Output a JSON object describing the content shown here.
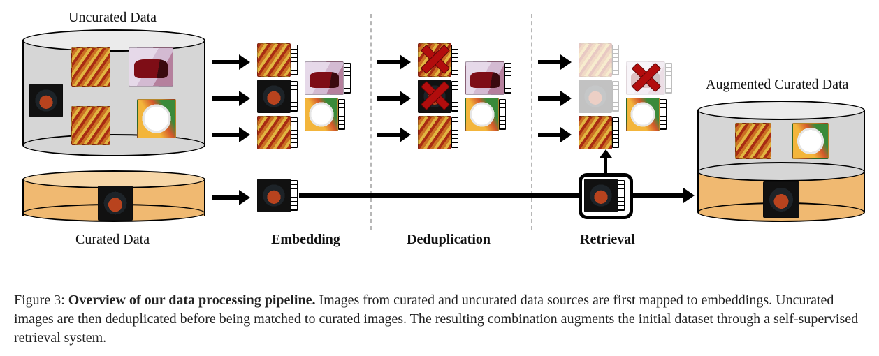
{
  "labels": {
    "uncurated": "Uncurated Data",
    "curated": "Curated Data",
    "augmented": "Augmented Curated Data",
    "embedding": "Embedding",
    "deduplication": "Deduplication",
    "retrieval": "Retrieval"
  },
  "caption": {
    "prefix": "Figure 3: ",
    "title": "Overview of our data processing pipeline.",
    "body": " Images from curated and uncurated data sources are first mapped to embeddings. Uncurated images are then deduplicated before being matched to curated images. The resulting combination augments the initial dataset through a self-supervised retrieval system."
  },
  "pipeline": {
    "stages": [
      "Embedding",
      "Deduplication",
      "Retrieval"
    ],
    "uncurated_samples": [
      "pie",
      "ratatouille",
      "ratatouille2",
      "car",
      "plate"
    ],
    "curated_samples": [
      "pie-curated"
    ],
    "dedup_removed_indices": [
      0,
      1
    ],
    "retrieval_kept": [
      "ratatouille2",
      "plate"
    ],
    "augmented_output": {
      "from_uncurated": [
        "ratatouille2",
        "plate"
      ],
      "from_curated": [
        "pie-curated"
      ]
    }
  }
}
